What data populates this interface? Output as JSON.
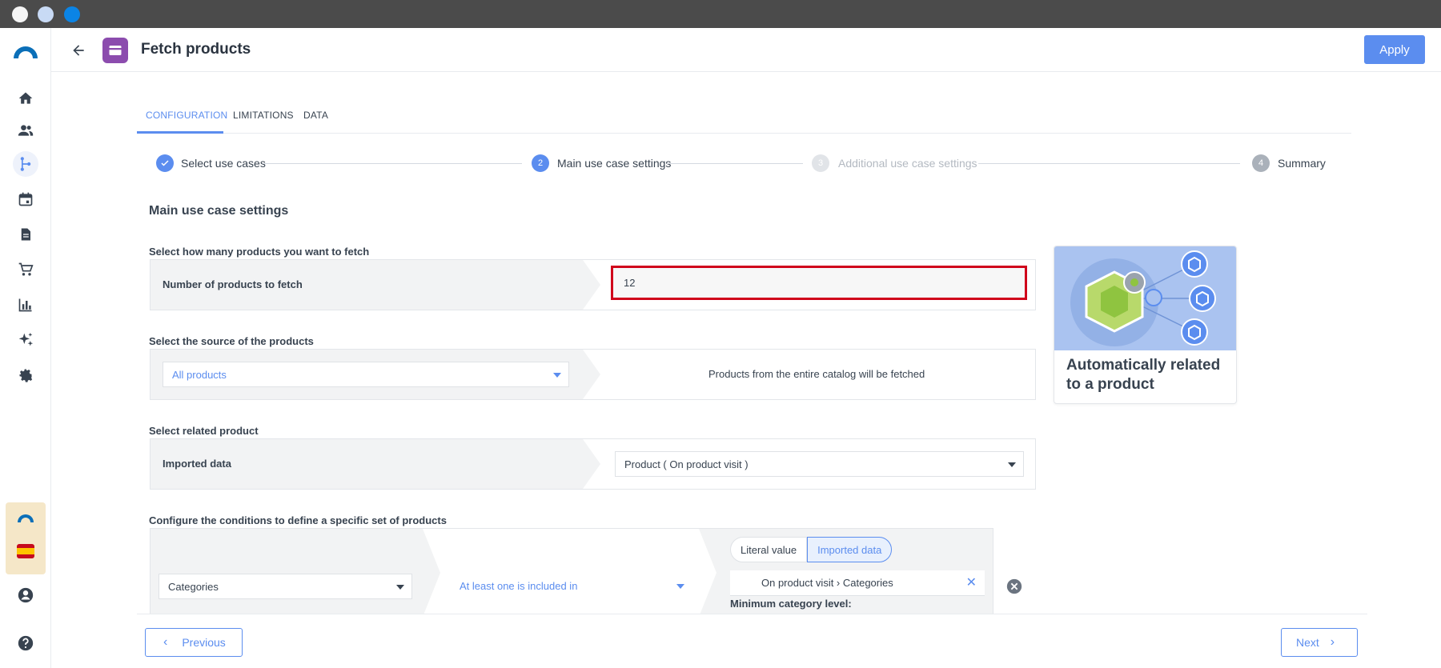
{
  "header": {
    "title": "Fetch products",
    "apply_label": "Apply"
  },
  "tabs": [
    {
      "label": "CONFIGURATION",
      "active": true
    },
    {
      "label": "LIMITATIONS",
      "active": false
    },
    {
      "label": "DATA",
      "active": false
    }
  ],
  "stepper": [
    {
      "number": "1",
      "label": "Select use cases",
      "state": "done"
    },
    {
      "number": "2",
      "label": "Main use case settings",
      "state": "active"
    },
    {
      "number": "3",
      "label": "Additional use case settings",
      "state": "disabled"
    },
    {
      "number": "4",
      "label": "Summary",
      "state": "pending"
    }
  ],
  "main": {
    "section_title": "Main use case settings",
    "fetch_group": {
      "label": "Select how many products you want to fetch",
      "row_label": "Number of products to fetch",
      "value": "12"
    },
    "source_group": {
      "label": "Select the source of the products",
      "selected": "All products",
      "info": "Products from the entire catalog will be fetched"
    },
    "related_group": {
      "label": "Select related product",
      "row_label": "Imported data",
      "selected": "Product ( On product visit )"
    },
    "conditions_group": {
      "label": "Configure the conditions to define a specific set of products",
      "attribute": "Categories",
      "operator": "At least one is included in",
      "toggle_literal": "Literal value",
      "toggle_imported": "Imported data",
      "chip": "On product visit › Categories",
      "min_level_label": "Minimum category level:"
    }
  },
  "card": {
    "title": "Automatically related to a product"
  },
  "footer": {
    "previous_label": "Previous",
    "next_label": "Next"
  },
  "colors": {
    "accent": "#5b8def",
    "highlight": "#d0021b",
    "node": "#8c4cae"
  }
}
